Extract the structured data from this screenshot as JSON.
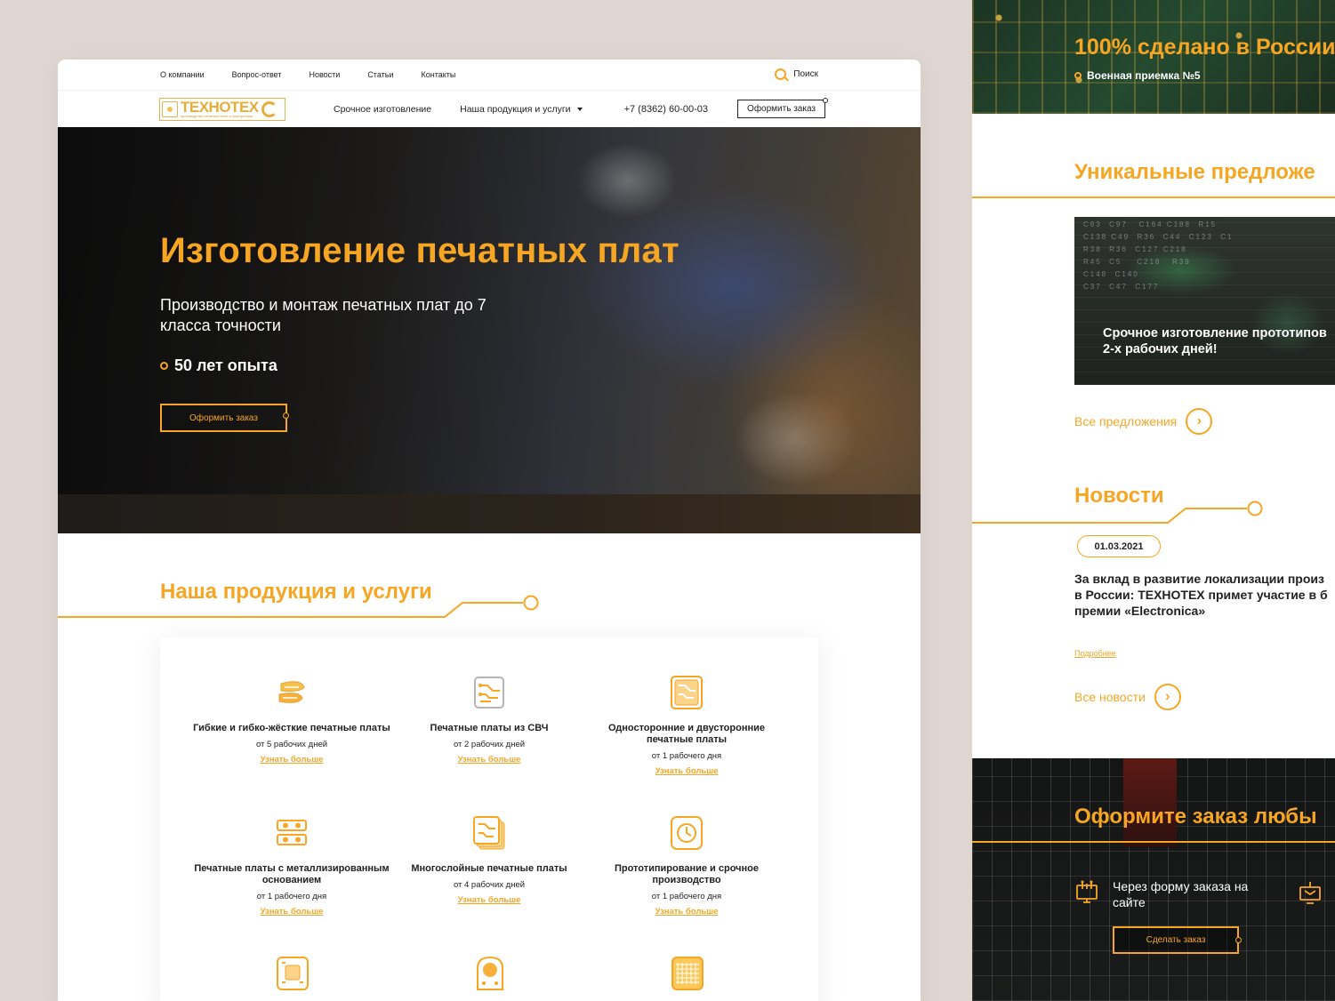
{
  "topbar": {
    "links": [
      "О компании",
      "Вопрос-ответ",
      "Новости",
      "Статьи",
      "Контакты"
    ],
    "search_label": "Поиск"
  },
  "navbar": {
    "logo_text": "ТЕХНОТЕХ",
    "logo_sub": "производство печатных плат и электроники",
    "urgent": "Срочное изготовление",
    "products": "Наша продукция и услуги",
    "phone": "+7 (8362) 60-00-03",
    "order_button": "Оформить заказ"
  },
  "hero": {
    "title": "Изготовление печатных плат",
    "subtitle": "Производство и монтаж печатных плат до 7 класса точности",
    "experience": "50 лет опыта",
    "button": "Оформить заказ"
  },
  "products": {
    "title": "Наша продукция и услуги",
    "more_label": "Узнать больше",
    "items": [
      {
        "name": "Гибкие и гибко-жёсткие печатные платы",
        "time": "от 5 рабочих дней",
        "icon": "flex-pcb-icon"
      },
      {
        "name": "Печатные платы из СВЧ",
        "time": "от 2 рабочих дней",
        "icon": "microwave-pcb-icon"
      },
      {
        "name": "Односторонние и двусторонние печатные платы",
        "time": "от 1 рабочего дня",
        "icon": "double-sided-pcb-icon"
      },
      {
        "name": "Печатные платы с металлизированным основанием",
        "time": "от 1 рабочего дня",
        "icon": "metal-core-pcb-icon"
      },
      {
        "name": "Многослойные печатные платы",
        "time": "от 4 рабочих дней",
        "icon": "multilayer-pcb-icon"
      },
      {
        "name": "Прототипирование и срочное производство",
        "time": "от 1 рабочего дня",
        "icon": "clock-icon"
      }
    ]
  },
  "side": {
    "made_in": "100% сделано в России",
    "military": "Военная приемка №5",
    "unique_title": "Уникальные предложе",
    "offer_caption_1": "Срочное изготовление прототипов",
    "offer_caption_2": "2-х рабочих дней!",
    "all_offers": "Все предложения",
    "news_title": "Новости",
    "news_date": "01.03.2021",
    "news_line_1": "За вклад в развитие локализации произ",
    "news_line_2": "в России: ТЕХНОТЕХ примет участие в б",
    "news_line_3": "премии «Electronica»",
    "news_more": "Подробнее",
    "all_news": "Все новости",
    "cta_title": "Оформите заказ любы",
    "cta_item": "Через форму заказа на сайте",
    "cta_button": "Сделать заказ"
  },
  "colors": {
    "accent": "#f6a623",
    "dark": "#222222"
  }
}
